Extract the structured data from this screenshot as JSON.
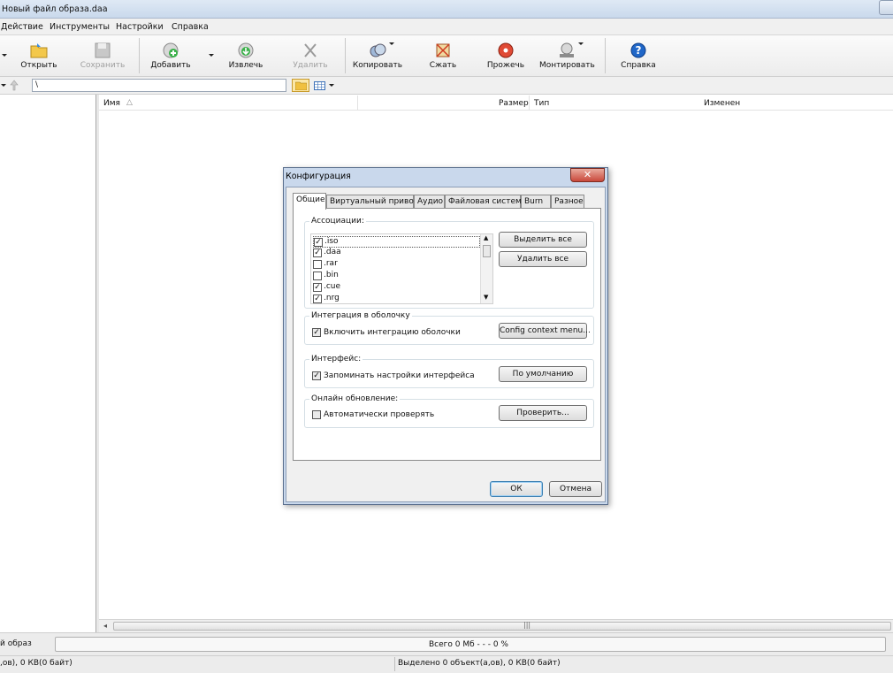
{
  "window": {
    "title": "Новый файл образа.daa"
  },
  "menu": [
    "Действие",
    "Инструменты",
    "Настройки",
    "Справка"
  ],
  "toolbar": {
    "open": "Открыть",
    "save": "Сохранить",
    "add": "Добавить",
    "extract": "Извлечь",
    "delete": "Удалить",
    "copy": "Копировать",
    "compress": "Сжать",
    "burn": "Прожечь",
    "mount": "Монтировать",
    "help": "Справка"
  },
  "address": {
    "path": "\\"
  },
  "columns": {
    "name": "Имя",
    "size": "Размер",
    "type": "Тип",
    "modified": "Изменен"
  },
  "status": {
    "image_type": "й образ",
    "total": "Всего  0 Мб   - - -  0 %",
    "left_info": ",ов), 0 КВ(0 байт)",
    "selected": "Выделено 0 объект(а,ов), 0 КВ(0 байт)"
  },
  "dialog": {
    "title": "Конфигурация",
    "tabs": [
      "Общие",
      "Виртуальный привод",
      "Аудио",
      "Файловая система",
      "Burn",
      "Разное"
    ],
    "associations": {
      "label": "Ассоциации:",
      "items": [
        {
          "ext": ".iso",
          "checked": true
        },
        {
          "ext": ".daa",
          "checked": true
        },
        {
          "ext": ".rar",
          "checked": false
        },
        {
          "ext": ".bin",
          "checked": false
        },
        {
          "ext": ".cue",
          "checked": true
        },
        {
          "ext": ".nrg",
          "checked": true
        }
      ],
      "select_all": "Выделить все",
      "delete_all": "Удалить все"
    },
    "shell": {
      "label": "Интеграция в оболочку",
      "checkbox": "Включить интеграцию оболочки",
      "button": "Config context menu..."
    },
    "interface": {
      "label": "Интерфейс:",
      "checkbox": "Запоминать настройки интерфейса",
      "button": "По умолчанию"
    },
    "update": {
      "label": "Онлайн обновление:",
      "checkbox": "Автоматически проверять",
      "button": "Проверить..."
    },
    "ok": "ОК",
    "cancel": "Отмена"
  },
  "colors": {
    "dialog_frame": "#c9d8ec",
    "close_button": "#c9473a",
    "window_bg": "#f0f0f0"
  }
}
